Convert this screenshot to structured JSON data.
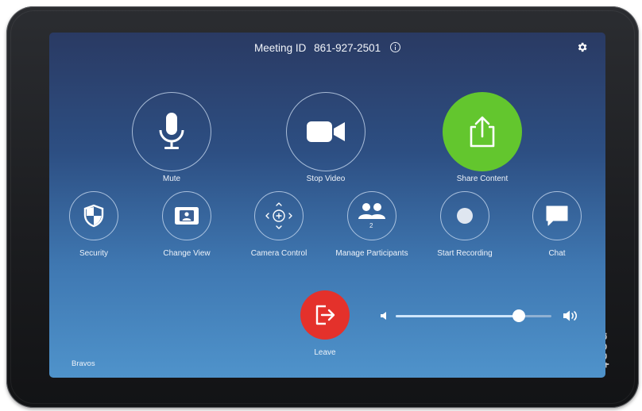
{
  "device": {
    "brand": "neat."
  },
  "header": {
    "meeting_id_label": "Meeting ID",
    "meeting_id": "861-927-2501",
    "info_icon": "info-icon",
    "settings_icon": "gear-icon"
  },
  "primary_actions": [
    {
      "label": "Mute",
      "icon": "microphone-icon"
    },
    {
      "label": "Stop Video",
      "icon": "video-camera-icon"
    },
    {
      "label": "Share Content",
      "icon": "share-icon",
      "color": "#63c62e"
    }
  ],
  "secondary_actions": [
    {
      "label": "Security",
      "icon": "shield-icon"
    },
    {
      "label": "Change View",
      "icon": "gallery-view-icon"
    },
    {
      "label": "Camera Control",
      "icon": "camera-dpad-icon"
    },
    {
      "label": "Manage Participants",
      "icon": "participants-icon",
      "badge": "2"
    },
    {
      "label": "Start Recording",
      "icon": "record-icon"
    },
    {
      "label": "Chat",
      "icon": "chat-icon"
    }
  ],
  "leave": {
    "label": "Leave",
    "icon": "exit-icon",
    "color": "#e4312b"
  },
  "volume": {
    "level": 0.79
  },
  "room_name": "Bravos"
}
